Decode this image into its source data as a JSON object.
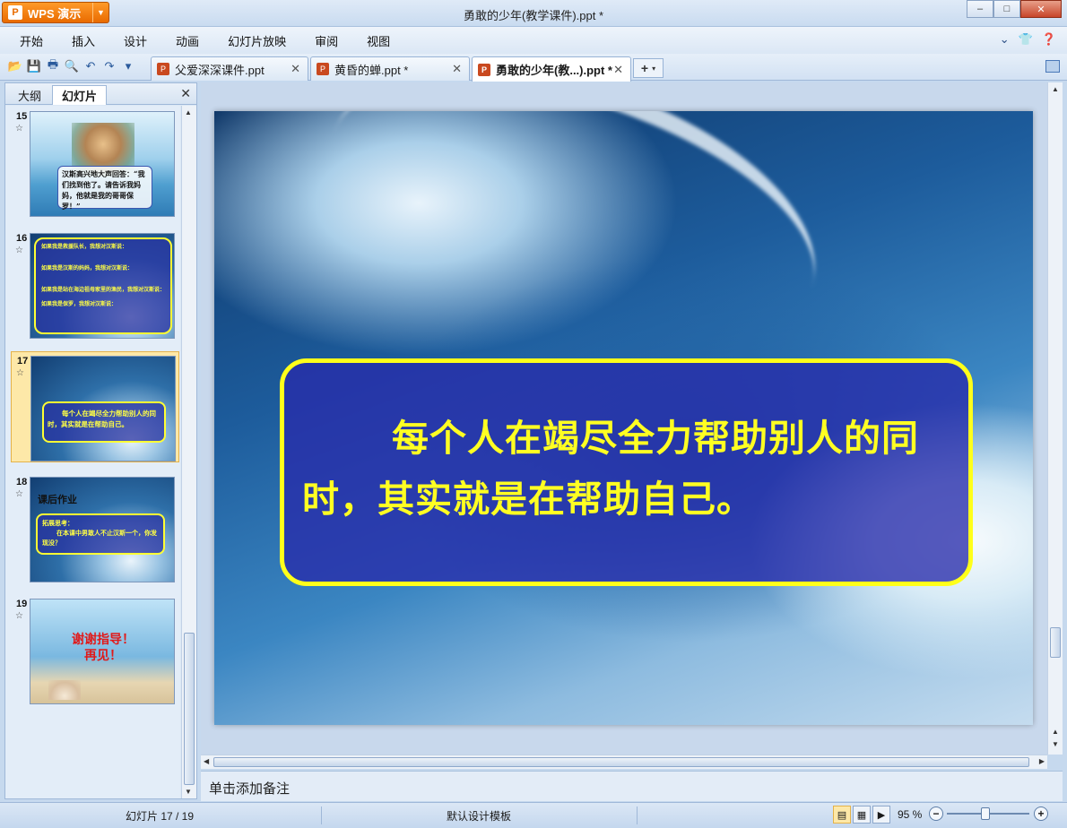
{
  "app": {
    "name": "WPS 演示",
    "logo_text": "P",
    "document_title": "勇敢的少年(教学课件).ppt *"
  },
  "window_controls": {
    "minimize": "–",
    "maximize": "□",
    "close": "✕"
  },
  "menu": {
    "items": [
      "开始",
      "插入",
      "设计",
      "动画",
      "幻灯片放映",
      "审阅",
      "视图"
    ]
  },
  "doc_tabs": [
    {
      "label": "父爱深深课件.ppt",
      "active": false
    },
    {
      "label": "黄昏的蝉.ppt *",
      "active": false
    },
    {
      "label": "勇敢的少年(教...).ppt *",
      "active": true
    }
  ],
  "left_panel": {
    "tabs": [
      "大纲",
      "幻灯片"
    ],
    "active_tab": "幻灯片",
    "slides": [
      {
        "number": "15",
        "text": "汉斯高兴地大声回答：“我们找到他了。请告诉我妈妈，他就是我的哥哥保罗！”"
      },
      {
        "number": "16",
        "lines": [
          "如果我是救援队长，我想对汉斯说：",
          "如果我是汉斯的妈妈，我想对汉斯说：",
          "如果我是站在海边祖母家里的渔民，我想对汉斯说：",
          "如果我是保罗，我想对汉斯说："
        ]
      },
      {
        "number": "17",
        "text": "每个人在竭尽全力帮助别人的同时，其实就是在帮助自己。"
      },
      {
        "number": "18",
        "title": "课后作业",
        "text_lead": "拓展思考：",
        "text_body": "在本课中男敢人不止汉斯一个，你发现没？"
      },
      {
        "number": "19",
        "line1": "谢谢指导！",
        "line2": "再见！"
      }
    ]
  },
  "main_slide": {
    "text": "每个人在竭尽全力帮助别人的同时，其实就是在帮助自己。"
  },
  "notes_placeholder": "单击添加备注",
  "status_bar": {
    "slide_indicator": "幻灯片 17 / 19",
    "template": "默认设计模板",
    "zoom": "95 %"
  },
  "colors": {
    "accent_orange": "#e96b00",
    "slide_text_yellow": "#ffff22",
    "box_blue": "#282caa"
  }
}
